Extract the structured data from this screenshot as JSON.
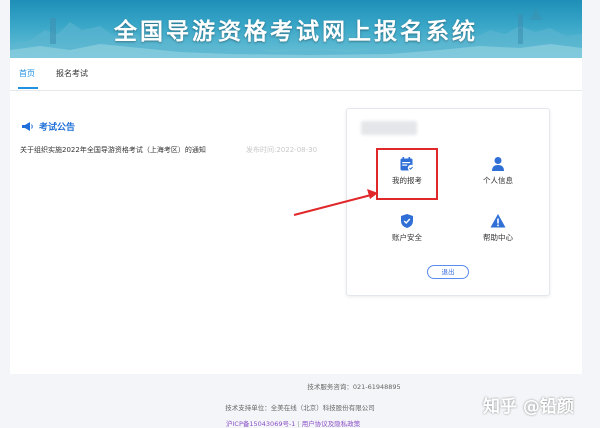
{
  "banner": {
    "title": "全国导游资格考试网上报名系统"
  },
  "nav": {
    "items": [
      {
        "label": "首页"
      },
      {
        "label": "报名考试"
      }
    ]
  },
  "notice": {
    "title": "考试公告",
    "items": [
      {
        "text": "关于组织实施2022年全国导游资格考试（上海考区）的通知",
        "date": "发布时间:2022-08-30"
      }
    ]
  },
  "panel": {
    "tiles": [
      {
        "label": "我的报考",
        "icon": "calendar-check-icon"
      },
      {
        "label": "个人信息",
        "icon": "user-icon"
      },
      {
        "label": "账户安全",
        "icon": "shield-check-icon"
      },
      {
        "label": "帮助中心",
        "icon": "warning-icon"
      }
    ],
    "logout_label": "退出"
  },
  "footer": {
    "phone": "技术服务咨询：021-61948895",
    "support": "技术支持单位：全美在线（北京）科技股份有限公司",
    "icp": "沪ICP备15043069号-1",
    "policy": "用户协议及隐私政策"
  },
  "watermark": "知乎 @铅颜",
  "colors": {
    "accent": "#1e8fe1",
    "highlight": "#e0282a",
    "banner": "#1e8fb8"
  }
}
